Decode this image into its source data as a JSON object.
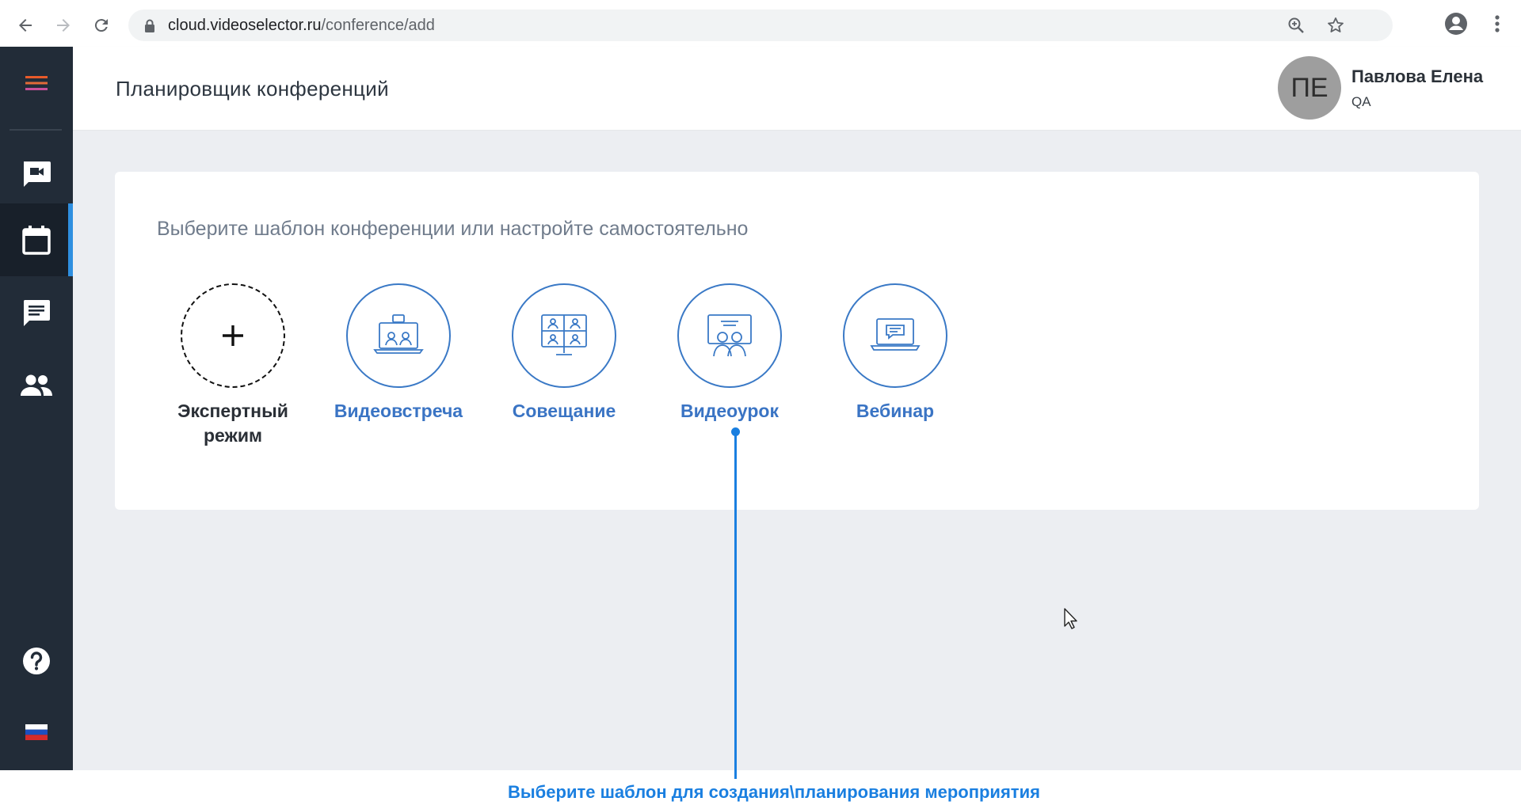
{
  "browser": {
    "url_host": "cloud.videoselector.ru",
    "url_path": "/conference/add",
    "icons": [
      "back-icon",
      "forward-icon",
      "reload-icon",
      "lock-icon",
      "zoom-icon",
      "bookmark-star-icon",
      "account-icon",
      "more-vert-icon"
    ]
  },
  "sidebar": {
    "items": [
      {
        "name": "menu",
        "icon": "hamburger-icon"
      },
      {
        "name": "conferences",
        "icon": "video-chat-icon"
      },
      {
        "name": "planner",
        "icon": "calendar-icon",
        "active": true
      },
      {
        "name": "messages",
        "icon": "chat-icon"
      },
      {
        "name": "contacts",
        "icon": "people-icon"
      },
      {
        "name": "help",
        "icon": "help-icon"
      },
      {
        "name": "language",
        "icon": "russian-flag-icon"
      }
    ]
  },
  "header": {
    "title": "Планировщик конференций",
    "user": {
      "initials": "ПЕ",
      "name": "Павлова Елена",
      "role": "QA"
    }
  },
  "main": {
    "card_title": "Выберите шаблон конференции или настройте самостоятельно",
    "templates": [
      {
        "label": "Экспертный режим",
        "icon": "plus-icon"
      },
      {
        "label": "Видеовстреча",
        "icon": "laptop-video-meeting-icon"
      },
      {
        "label": "Совещание",
        "icon": "monitor-grid-meeting-icon"
      },
      {
        "label": "Видеоурок",
        "icon": "screen-lesson-icon"
      },
      {
        "label": "Вебинар",
        "icon": "laptop-webinar-icon"
      }
    ]
  },
  "annotation": {
    "text": "Выберите шаблон для создания\\планирования мероприятия"
  },
  "colors": {
    "sidebar_bg": "#222c38",
    "accent_blue": "#3a79c6",
    "annotation_blue": "#1a7fe0",
    "active_indicator": "#2f8fe0",
    "hamburger_accent": "#f26b2d"
  }
}
